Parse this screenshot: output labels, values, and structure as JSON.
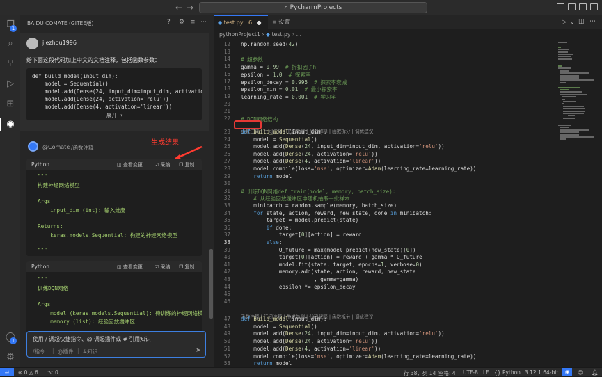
{
  "titlebar": {
    "search": "PycharmProjects"
  },
  "activity": {
    "badge1": "1",
    "badge2": "1"
  },
  "sidebar": {
    "title": "BAIDU COMATE (GITEE版)",
    "user": {
      "name": "jiezhou1996"
    },
    "question": "给下面这段代码加上中文的文档注释，包括函数参数：",
    "code_lines": [
      "def build_model(input_dim):",
      "    model = Sequential()",
      "    model.add(Dense(24, input_dim=input_dim, activation=",
      "    model.add(Dense(24, activation='relu'))",
      "    model.add(Dense(4, activation='linear'))"
    ],
    "expand_label": "展开 ▾",
    "bot": {
      "name": "@Comate",
      "command": "/函数注释"
    },
    "annotation": "生成结果",
    "resp1": {
      "lang": "Python",
      "view": "查看变更",
      "accept": "采纳",
      "copy": "复制",
      "lines": [
        "\"\"\"",
        "构建神经网络模型",
        "",
        "Args:",
        "    input_dim (int): 输入维度",
        "",
        "Returns:",
        "    keras.models.Sequential: 构建的神经网络模型",
        "",
        "\"\"\""
      ]
    },
    "resp2": {
      "lang": "Python",
      "view": "查看变更",
      "accept": "采纳",
      "copy": "复制",
      "lines": [
        "\"\"\"",
        "训练DQN网络",
        "",
        "Args:",
        "    model (keras.models.Sequential): 待训练的神经网络模!",
        "    memory (list): 经验回放缓冲区"
      ]
    },
    "input": {
      "placeholder": "使用 / 调起快捷指令、@ 调起插件或 # 引用知识",
      "cmd": "/指令",
      "plugin": "@插件",
      "knowledge": "#知识"
    }
  },
  "editor": {
    "tabs": [
      {
        "label": "test.py",
        "count": "6"
      },
      {
        "label": "设置"
      }
    ],
    "breadcrumb": [
      "pythonProject1",
      "test.py",
      "..."
    ],
    "lens_text": "函数注释 | 行间注释 | 生成单测 | 代码解释 | 函数拆分 | 调优建议",
    "lens_first": "函数注释",
    "lines1": [
      {
        "n": "12",
        "t": "np.random.seed(42)"
      },
      {
        "n": "13",
        "t": ""
      },
      {
        "n": "14",
        "t": "# 超参数"
      },
      {
        "n": "15",
        "t": "gamma = 0.99  # 折扣因子h"
      },
      {
        "n": "16",
        "t": "epsilon = 1.0  # 探索率"
      },
      {
        "n": "17",
        "t": "epsilon_decay = 0.995  # 探索率衰减"
      },
      {
        "n": "18",
        "t": "epsilon_min = 0.01  # 最小探索率"
      },
      {
        "n": "19",
        "t": "learning_rate = 0.001  # 学习率"
      },
      {
        "n": "20",
        "t": ""
      },
      {
        "n": "21",
        "t": ""
      },
      {
        "n": "22",
        "t": "# DQN网络结构"
      }
    ],
    "lines2": [
      {
        "n": "23",
        "t": "def build_model(input_dim):"
      },
      {
        "n": "24",
        "t": "    model = Sequential()"
      },
      {
        "n": "25",
        "t": "    model.add(Dense(24, input_dim=input_dim, activation='relu'))"
      },
      {
        "n": "26",
        "t": "    model.add(Dense(24, activation='relu'))"
      },
      {
        "n": "27",
        "t": "    model.add(Dense(4, activation='linear'))"
      },
      {
        "n": "28",
        "t": "    model.compile(loss='mse', optimizer=Adam(learning_rate=learning_rate))"
      },
      {
        "n": "29",
        "t": "    return model"
      },
      {
        "n": "30",
        "t": ""
      },
      {
        "n": "31",
        "t": "# 训练DQN网络def train(model, memory, batch_size):"
      },
      {
        "n": "32",
        "t": "    # 从经验回放缓冲区中随机抽取一批样本"
      },
      {
        "n": "33",
        "t": "    minibatch = random.sample(memory, batch_size)"
      },
      {
        "n": "34",
        "t": "    for state, action, reward, new_state, done in minibatch:"
      },
      {
        "n": "35",
        "t": "        target = model.predict(state)"
      },
      {
        "n": "36",
        "t": "        if done:"
      },
      {
        "n": "37",
        "t": "            target[0][action] = reward"
      },
      {
        "n": "38",
        "t": "        else:"
      },
      {
        "n": "39",
        "t": "            Q_future = max(model.predict(new_state)[0])"
      },
      {
        "n": "40",
        "t": "            target[0][action] = reward + gamma * Q_future"
      },
      {
        "n": "41",
        "t": "            model.fit(state, target, epochs=1, verbose=0)"
      },
      {
        "n": "42",
        "t": "            memory.add(state, action, reward, new_state"
      },
      {
        "n": "43",
        "t": "                       , gamma=gamma)"
      },
      {
        "n": "44",
        "t": "            epsilon *= epsilon_decay"
      },
      {
        "n": "45",
        "t": ""
      },
      {
        "n": "46",
        "t": ""
      }
    ],
    "lines3": [
      {
        "n": "47",
        "t": "def build_model(input_dim):"
      },
      {
        "n": "48",
        "t": "    model = Sequential()"
      },
      {
        "n": "49",
        "t": "    model.add(Dense(24, input_dim=input_dim, activation='relu'))"
      },
      {
        "n": "50",
        "t": "    model.add(Dense(24, activation='relu'))"
      },
      {
        "n": "51",
        "t": "    model.add(Dense(4, activation='linear'))"
      },
      {
        "n": "52",
        "t": "    model.compile(loss='mse', optimizer=Adam(learning_rate=learning_rate))"
      },
      {
        "n": "53",
        "t": "    return model"
      }
    ]
  },
  "status": {
    "errors": "0",
    "warnings": "6",
    "ports": "0",
    "position": "行 38，列 14",
    "spaces": "空格: 4",
    "encoding": "UTF-8",
    "eol": "LF",
    "language": "Python",
    "interpreter": "3.12.1 64-bit"
  },
  "colors": {
    "accent": "#3478f6",
    "annotation": "#ff3b30"
  }
}
